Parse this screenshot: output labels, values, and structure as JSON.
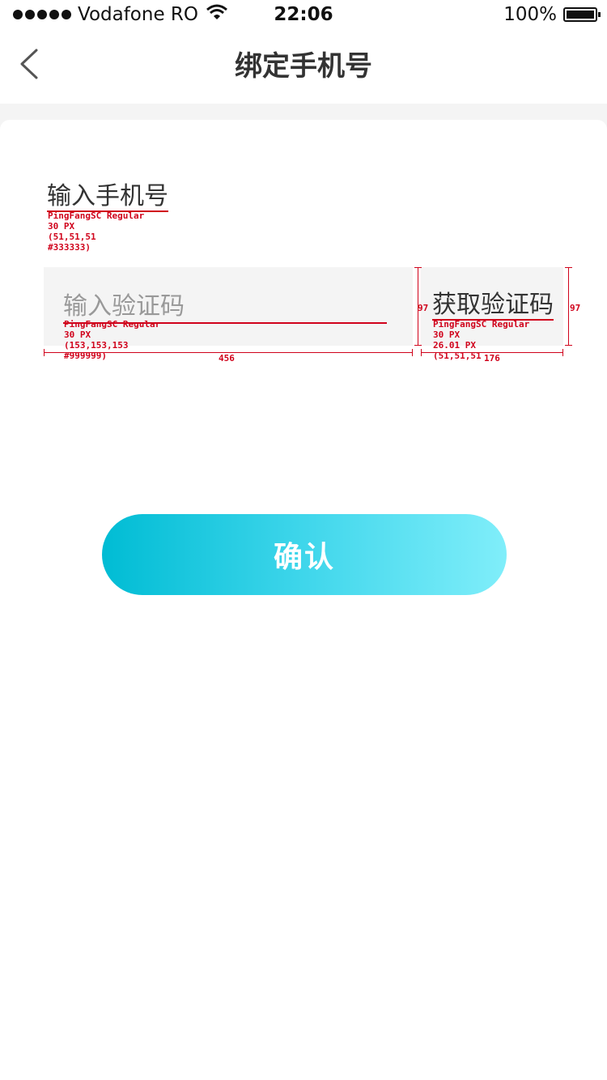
{
  "status_bar": {
    "carrier": "Vodafone RO",
    "time": "22:06",
    "battery": "100%"
  },
  "nav": {
    "title": "绑定手机号",
    "back_icon": "chevron-left-icon"
  },
  "form": {
    "phone_label": "输入手机号",
    "phone_annotation": [
      "PingFangSC Regular",
      "30 PX",
      "(51,51,51",
      "#333333)"
    ],
    "code_placeholder": "输入验证码",
    "code_value": "",
    "code_annotation": [
      "PingFangSC Regular",
      "30 PX",
      "(153,153,153",
      "#999999)"
    ],
    "get_code_label": "获取验证码",
    "get_code_annotation": [
      "PingFangSC Regular",
      "30 PX",
      "26.01 PX",
      "(51,51,51"
    ],
    "dim_code_width": "456",
    "dim_code_height": "97",
    "dim_button_width": "176",
    "dim_button_height": "97"
  },
  "confirm_label": "确认",
  "colors": {
    "accent_start": "#00bcd4",
    "accent_end": "#80eefa",
    "text": "#333333",
    "placeholder": "#999999",
    "annotation": "#d0021b"
  }
}
